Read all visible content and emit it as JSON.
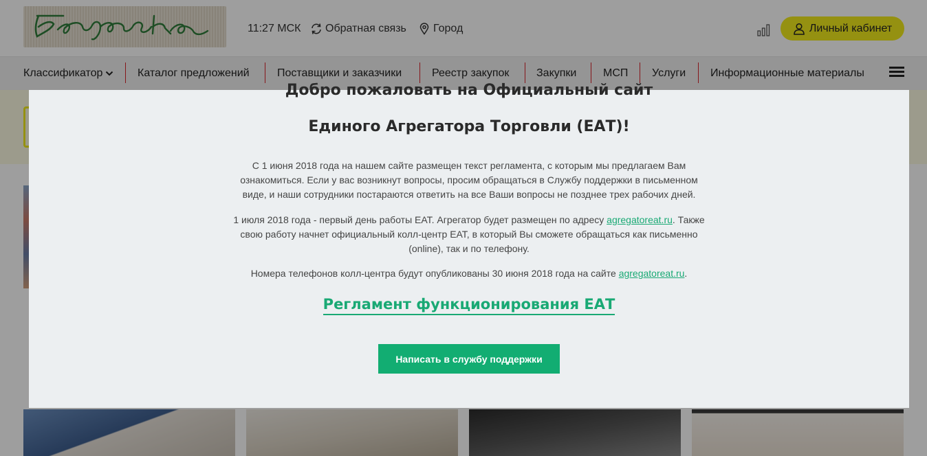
{
  "header": {
    "logo_alt": "Березка",
    "time": "11:27 МСК",
    "feedback": "Обратная связь",
    "city": "Город",
    "cabinet": "Личный кабинет"
  },
  "nav": {
    "items": [
      "Классификатор",
      "Каталог предложений",
      "Поставщики и заказчики",
      "Реестр закупок",
      "Закупки",
      "МСП",
      "Услуги",
      "Информационные материалы"
    ]
  },
  "modal": {
    "title_line1": "Добро пожаловать на Официальный сайт",
    "title_line2": "Единого Агрегатора Торговли (ЕАТ)!",
    "p1": "С 1 июня 2018 года на нашем сайте размещен текст регламента, с которым мы предлагаем Вам ознакомиться. Если у вас возникнут вопросы, просим обращаться в Службу поддержки в письменном виде, и наши сотрудники постараются ответить на все Ваши вопросы не позднее трех рабочих дней.",
    "p2_before": "1 июля 2018 года - первый день работы ЕАТ. Агрегатор будет размещен по адресу ",
    "p2_link": "agregatoreat.ru",
    "p2_after": ". Также свою работу начнет официальный колл-центр ЕАТ, в который Вы сможете обращаться как письменно (online), так и по телефону.",
    "p3_before": "Номера телефонов колл-центра будут опубликованы 30 июня 2018 года на сайте ",
    "p3_link": "agregatoreat.ru",
    "p3_after": ".",
    "regulation_link": "Регламент функционирования ЕАТ",
    "support_button": "Написать в службу поддержки"
  },
  "colors": {
    "accent_green": "#19a974",
    "button_green": "#12ad72",
    "cabinet_yellow": "#f1ea1c",
    "nav_separator": "#d8222a"
  }
}
